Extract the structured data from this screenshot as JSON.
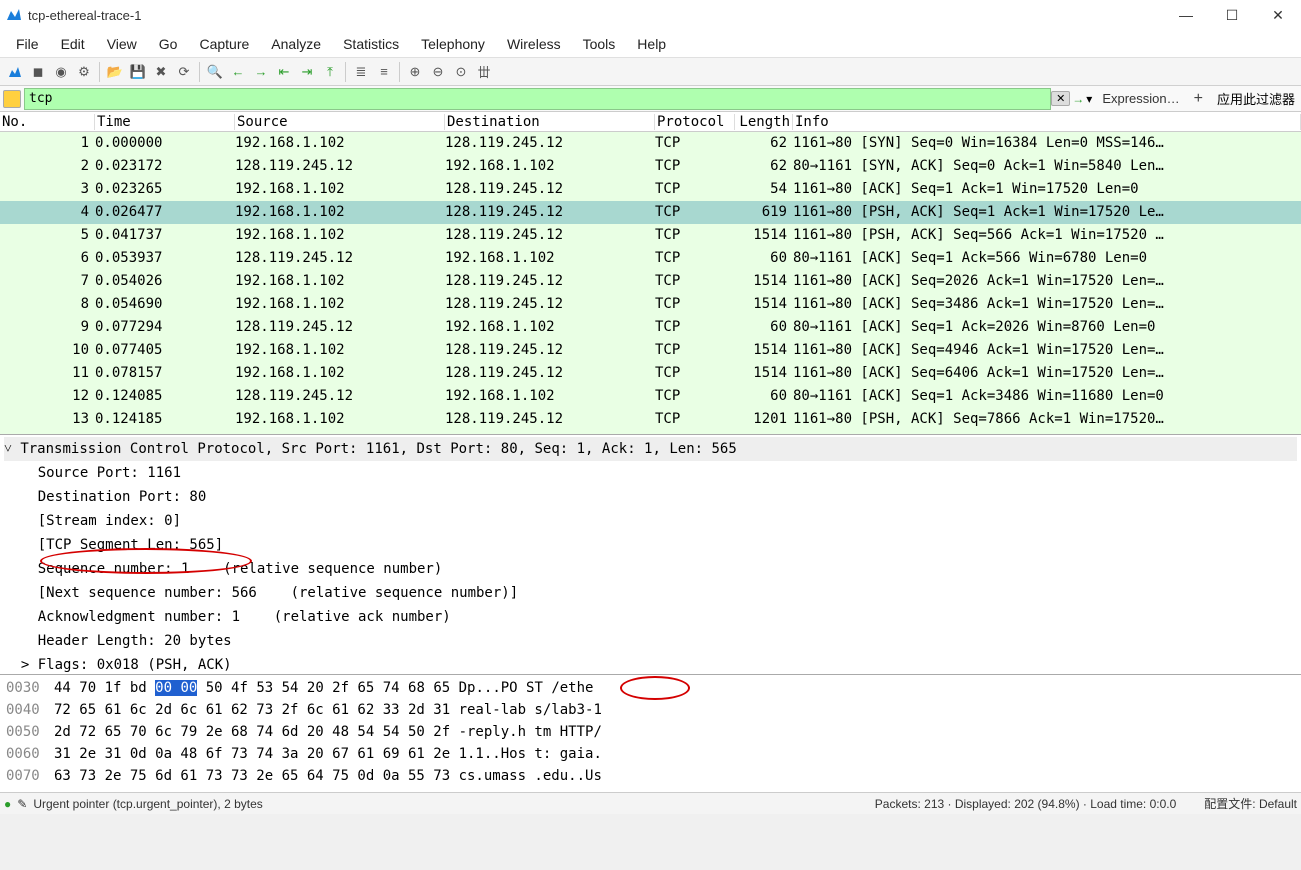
{
  "window": {
    "title": "tcp-ethereal-trace-1"
  },
  "menu": [
    "File",
    "Edit",
    "View",
    "Go",
    "Capture",
    "Analyze",
    "Statistics",
    "Telephony",
    "Wireless",
    "Tools",
    "Help"
  ],
  "filter": {
    "value": "tcp",
    "expr_label": "Expression…",
    "apply_label": "应用此过滤器"
  },
  "columns": [
    "No.",
    "Time",
    "Source",
    "Destination",
    "Protocol",
    "Length",
    "Info"
  ],
  "packets": [
    {
      "no": "1",
      "time": "0.000000",
      "src": "192.168.1.102",
      "dst": "128.119.245.12",
      "proto": "TCP",
      "len": "62",
      "info": "1161→80 [SYN] Seq=0 Win=16384 Len=0 MSS=146…"
    },
    {
      "no": "2",
      "time": "0.023172",
      "src": "128.119.245.12",
      "dst": "192.168.1.102",
      "proto": "TCP",
      "len": "62",
      "info": "80→1161 [SYN, ACK] Seq=0 Ack=1 Win=5840 Len…"
    },
    {
      "no": "3",
      "time": "0.023265",
      "src": "192.168.1.102",
      "dst": "128.119.245.12",
      "proto": "TCP",
      "len": "54",
      "info": "1161→80 [ACK] Seq=1 Ack=1 Win=17520 Len=0"
    },
    {
      "no": "4",
      "time": "0.026477",
      "src": "192.168.1.102",
      "dst": "128.119.245.12",
      "proto": "TCP",
      "len": "619",
      "info": "1161→80 [PSH, ACK] Seq=1 Ack=1 Win=17520 Le…",
      "selected": true
    },
    {
      "no": "5",
      "time": "0.041737",
      "src": "192.168.1.102",
      "dst": "128.119.245.12",
      "proto": "TCP",
      "len": "1514",
      "info": "1161→80 [PSH, ACK] Seq=566 Ack=1 Win=17520 …"
    },
    {
      "no": "6",
      "time": "0.053937",
      "src": "128.119.245.12",
      "dst": "192.168.1.102",
      "proto": "TCP",
      "len": "60",
      "info": "80→1161 [ACK] Seq=1 Ack=566 Win=6780 Len=0"
    },
    {
      "no": "7",
      "time": "0.054026",
      "src": "192.168.1.102",
      "dst": "128.119.245.12",
      "proto": "TCP",
      "len": "1514",
      "info": "1161→80 [ACK] Seq=2026 Ack=1 Win=17520 Len=…"
    },
    {
      "no": "8",
      "time": "0.054690",
      "src": "192.168.1.102",
      "dst": "128.119.245.12",
      "proto": "TCP",
      "len": "1514",
      "info": "1161→80 [ACK] Seq=3486 Ack=1 Win=17520 Len=…"
    },
    {
      "no": "9",
      "time": "0.077294",
      "src": "128.119.245.12",
      "dst": "192.168.1.102",
      "proto": "TCP",
      "len": "60",
      "info": "80→1161 [ACK] Seq=1 Ack=2026 Win=8760 Len=0"
    },
    {
      "no": "10",
      "time": "0.077405",
      "src": "192.168.1.102",
      "dst": "128.119.245.12",
      "proto": "TCP",
      "len": "1514",
      "info": "1161→80 [ACK] Seq=4946 Ack=1 Win=17520 Len=…"
    },
    {
      "no": "11",
      "time": "0.078157",
      "src": "192.168.1.102",
      "dst": "128.119.245.12",
      "proto": "TCP",
      "len": "1514",
      "info": "1161→80 [ACK] Seq=6406 Ack=1 Win=17520 Len=…"
    },
    {
      "no": "12",
      "time": "0.124085",
      "src": "128.119.245.12",
      "dst": "192.168.1.102",
      "proto": "TCP",
      "len": "60",
      "info": "80→1161 [ACK] Seq=1 Ack=3486 Win=11680 Len=0"
    },
    {
      "no": "13",
      "time": "0.124185",
      "src": "192.168.1.102",
      "dst": "128.119.245.12",
      "proto": "TCP",
      "len": "1201",
      "info": "1161→80 [PSH, ACK] Seq=7866 Ack=1 Win=17520…"
    }
  ],
  "details": {
    "header": "Transmission Control Protocol, Src Port: 1161, Dst Port: 80, Seq: 1, Ack: 1, Len: 565",
    "lines": [
      "    Source Port: 1161",
      "    Destination Port: 80",
      "    [Stream index: 0]",
      "    [TCP Segment Len: 565]",
      "    Sequence number: 1    (relative sequence number)",
      "    [Next sequence number: 566    (relative sequence number)]",
      "    Acknowledgment number: 1    (relative ack number)",
      "    Header Length: 20 bytes",
      "  > Flags: 0x018 (PSH, ACK)"
    ]
  },
  "hex": [
    {
      "off": "0030",
      "b": "44 70 1f bd ",
      "sel": "00 00",
      "b2": " 50 4f  53 54 20 2f 65 74 68 65",
      "a": "   Dp...PO ST /ethe"
    },
    {
      "off": "0040",
      "b": "72 65 61 6c 2d 6c 61 62  73 2f 6c 61 62 33 2d 31",
      "a": "   real-lab s/lab3-1"
    },
    {
      "off": "0050",
      "b": "2d 72 65 70 6c 79 2e 68  74 6d 20 48 54 54 50 2f",
      "a": "   -reply.h tm HTTP/"
    },
    {
      "off": "0060",
      "b": "31 2e 31 0d 0a 48 6f 73  74 3a 20 67 61 69 61 2e",
      "a": "   1.1..Hos t: gaia."
    },
    {
      "off": "0070",
      "b": "63 73 2e 75 6d 61 73 73  2e 65 64 75 0d 0a 55 73",
      "a": "   cs.umass .edu..Us"
    }
  ],
  "status": {
    "field": "Urgent pointer (tcp.urgent_pointer), 2 bytes",
    "packets": "Packets: 213  · Displayed: 202 (94.8%)  ·  Load time: 0:0.0",
    "profile": "配置文件: Default"
  }
}
